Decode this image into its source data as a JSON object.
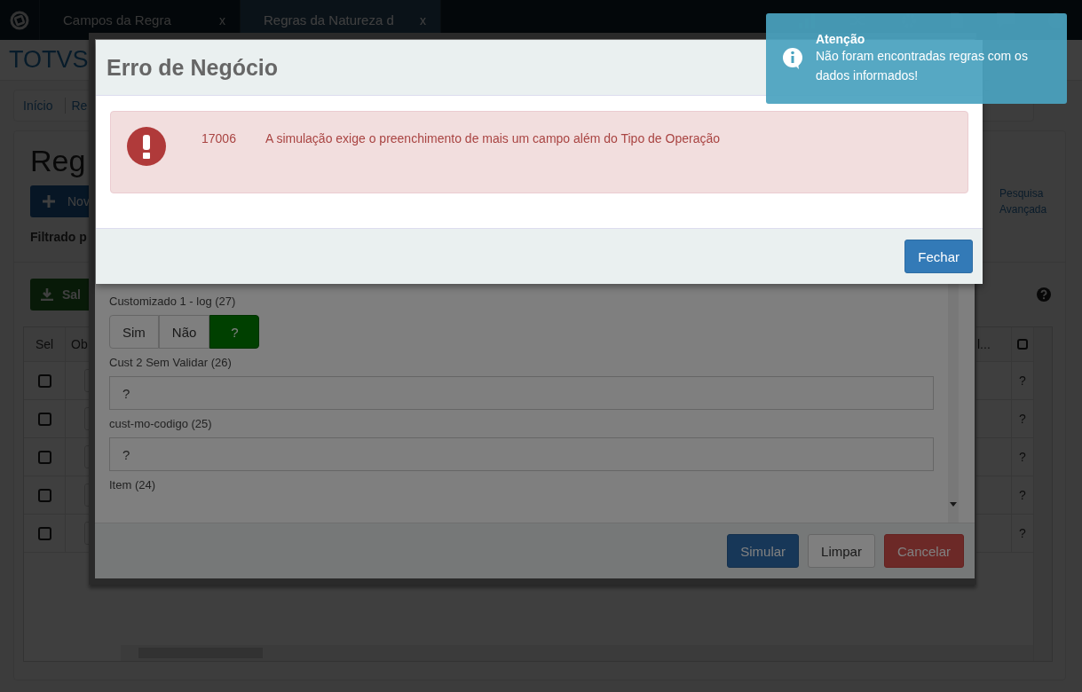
{
  "topbar": {
    "tabs": [
      {
        "label": "Campos da Regra",
        "close": "x",
        "selected": false
      },
      {
        "label": "Regras da Natureza d",
        "close": "x",
        "selected": true
      }
    ]
  },
  "header": {
    "brand": "TOTVS"
  },
  "breadcrumb": [
    "Início",
    "Re"
  ],
  "page": {
    "title": "Reg",
    "new_button": "Nov",
    "advanced_search": "Pesquisa Avançada",
    "filter_text": "Filtrado p",
    "save_button": "Sal"
  },
  "table": {
    "columns": [
      {
        "kind": "text",
        "label": "Sel"
      },
      {
        "kind": "text",
        "label": "Ob"
      },
      {
        "kind": "empty"
      },
      {
        "kind": "text",
        "label": "l..."
      },
      {
        "kind": "icon"
      }
    ],
    "rows": [
      {
        "checked": false,
        "value": "?"
      },
      {
        "checked": false,
        "value": "?"
      },
      {
        "checked": false,
        "value": "?"
      },
      {
        "checked": false,
        "value": "?"
      },
      {
        "checked": false,
        "value": "?"
      }
    ]
  },
  "simulation_modal": {
    "fields": [
      {
        "kind": "toggle",
        "label": "Customizado 1 - log (27)",
        "options": [
          {
            "label": "Sim",
            "selected": false
          },
          {
            "label": "Não",
            "selected": false
          },
          {
            "label": "?",
            "selected": true
          }
        ]
      },
      {
        "kind": "text",
        "label": "Cust 2 Sem Validar (26)",
        "value": "?"
      },
      {
        "kind": "text",
        "label": "cust-mo-codigo (25)",
        "value": "?"
      },
      {
        "kind": "label",
        "label": "Item (24)"
      }
    ],
    "buttons": [
      {
        "kind": "primary",
        "label": "Simular"
      },
      {
        "kind": "default",
        "label": "Limpar"
      },
      {
        "kind": "danger",
        "label": "Cancelar"
      }
    ]
  },
  "error_modal": {
    "title": "Erro de Negócio",
    "code": "17006",
    "message": "A simulação exige o preenchimento de mais um campo além do Tipo de Operação",
    "close_button": "Fechar"
  },
  "toast": {
    "title": "Atenção",
    "message": "Não foram encontradas regras com os dados informados!"
  }
}
